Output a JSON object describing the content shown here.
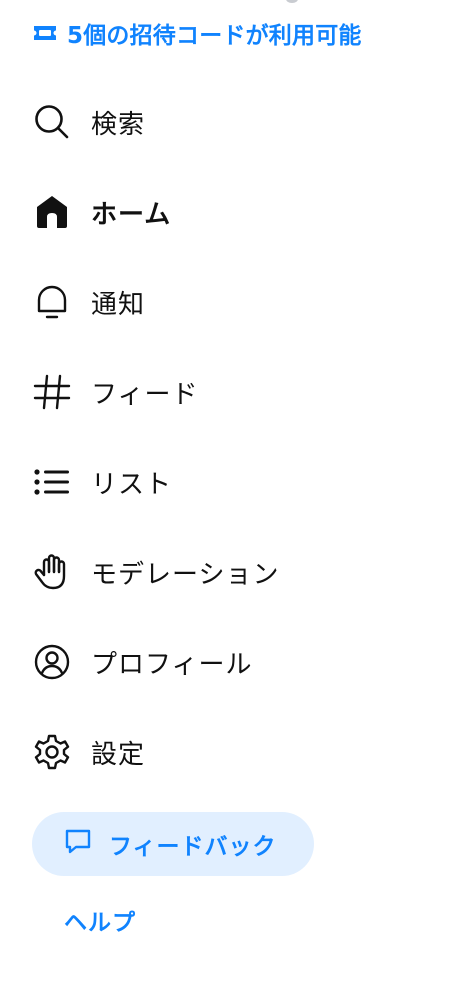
{
  "invite": {
    "icon": "ticket-icon",
    "text": "5個の招待コードが利用可能"
  },
  "nav": {
    "items": [
      {
        "label": "検索",
        "icon": "search-icon",
        "active": false
      },
      {
        "label": "ホーム",
        "icon": "home-icon",
        "active": true
      },
      {
        "label": "通知",
        "icon": "bell-icon",
        "active": false
      },
      {
        "label": "フィード",
        "icon": "hash-icon",
        "active": false
      },
      {
        "label": "リスト",
        "icon": "list-icon",
        "active": false
      },
      {
        "label": "モデレーション",
        "icon": "hand-icon",
        "active": false
      },
      {
        "label": "プロフィール",
        "icon": "profile-icon",
        "active": false
      },
      {
        "label": "設定",
        "icon": "gear-icon",
        "active": false
      }
    ]
  },
  "feedback": {
    "icon": "chat-bubble-icon",
    "label": "フィードバック"
  },
  "help": {
    "label": "ヘルプ"
  },
  "colors": {
    "accent": "#1083fe",
    "accent_light": "#e1efff",
    "text": "#111111"
  }
}
